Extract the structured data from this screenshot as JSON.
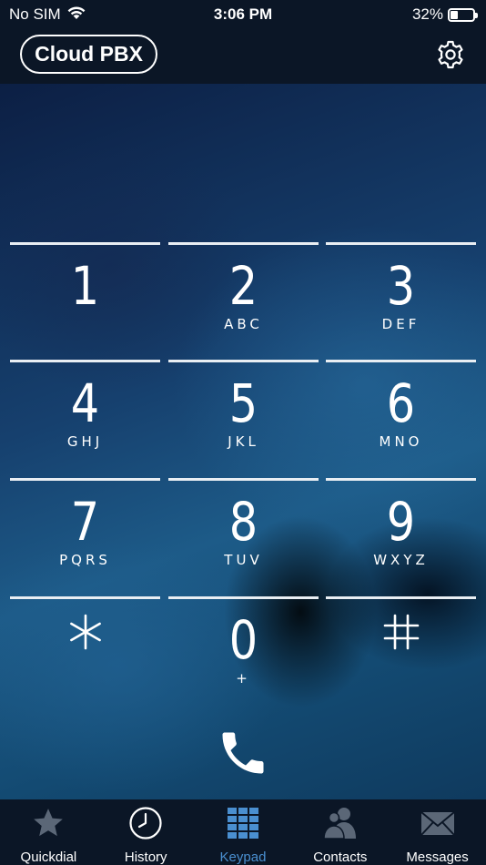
{
  "status_bar": {
    "carrier": "No SIM",
    "time": "3:06 PM",
    "battery_percent": "32%",
    "battery_level": 0.32
  },
  "header": {
    "title": "Cloud PBX",
    "settings_icon": "gear-icon"
  },
  "keypad": {
    "keys": [
      {
        "digit": "1",
        "letters": ""
      },
      {
        "digit": "2",
        "letters": "ABC"
      },
      {
        "digit": "3",
        "letters": "DEF"
      },
      {
        "digit": "4",
        "letters": "GHJ"
      },
      {
        "digit": "5",
        "letters": "JKL"
      },
      {
        "digit": "6",
        "letters": "MNO"
      },
      {
        "digit": "7",
        "letters": "PQRS"
      },
      {
        "digit": "8",
        "letters": "TUV"
      },
      {
        "digit": "9",
        "letters": "WXYZ"
      },
      {
        "digit": "*",
        "letters": ""
      },
      {
        "digit": "0",
        "letters": "+"
      },
      {
        "digit": "#",
        "letters": ""
      }
    ],
    "call_icon": "phone-icon"
  },
  "tabs": [
    {
      "label": "Quickdial",
      "icon": "star-icon",
      "active": false
    },
    {
      "label": "History",
      "icon": "clock-icon",
      "active": false
    },
    {
      "label": "Keypad",
      "icon": "keypad-grid-icon",
      "active": true
    },
    {
      "label": "Contacts",
      "icon": "contacts-icon",
      "active": false
    },
    {
      "label": "Messages",
      "icon": "envelope-icon",
      "active": false
    }
  ],
  "colors": {
    "bar_background": "#0b1626",
    "active_tab": "#4a8fd0",
    "inactive_icon": "#5b6777"
  }
}
